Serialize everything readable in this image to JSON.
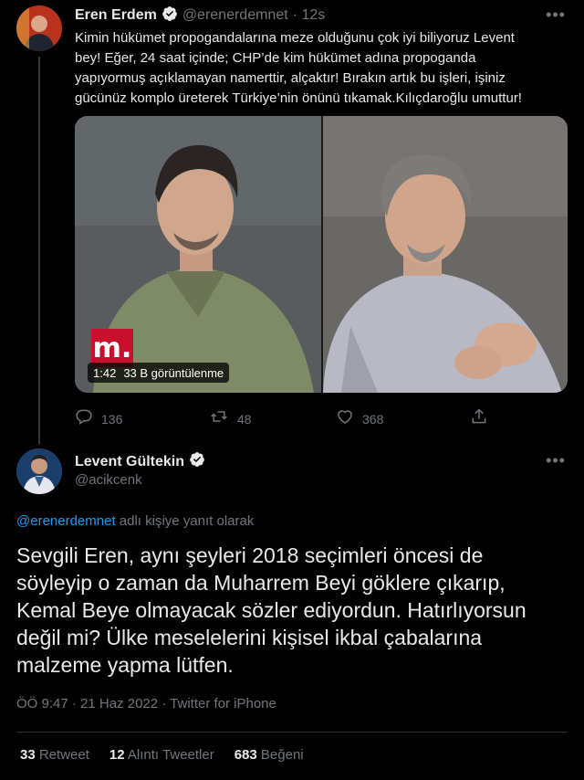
{
  "tweet1": {
    "display_name": "Eren Erdem",
    "handle": "@erenerdemnet",
    "time": "· 12s",
    "lines": [
      "Kimin hükümet propogandalarına meze olduğunu çok iyi biliyoruz Levent",
      "bey! Eğer, 24 saat içinde; CHP’de kim hükümet adına propoganda",
      "yapıyormuş açıklamayan namerttir, alçaktır! Bırakın artık bu işleri, işiniz",
      "gücünüz komplo üreterek Türkiye’nin önünü tıkamak.Kılıçdaroğlu umuttur!"
    ],
    "media": {
      "logo": "m.",
      "duration": "1:42",
      "views": "33 B görüntülenme"
    },
    "actions": {
      "replies": "136",
      "retweets": "48",
      "likes": "368"
    }
  },
  "tweet2": {
    "display_name": "Levent Gültekin",
    "handle": "@acikcenk",
    "reply_to_handle": "@erenerdemnet",
    "reply_to_suffix": " adlı kişiye yanıt olarak",
    "lines": [
      "Sevgili Eren, aynı şeyleri 2018 seçimleri öncesi de",
      "söyleyip o zaman da Muharrem Beyi göklere çıkarıp,",
      "Kemal Beye olmayacak sözler ediyordun. Hatırlıyorsun",
      "değil mi? Ülke meselelerini kişisel ikbal çabalarına",
      "malzeme yapma lütfen."
    ],
    "meta": "ÖÖ 9:47 · 21 Haz 2022 · Twitter for iPhone",
    "stats": {
      "retweets_count": "33",
      "retweets_label": "Retweet",
      "quotes_count": "12",
      "quotes_label": "Alıntı Tweetler",
      "likes_count": "683",
      "likes_label": "Beğeni"
    }
  },
  "colors": {
    "background": "#000000",
    "text": "#e7e9ea",
    "muted": "#71767b",
    "accent": "#1d9bf0",
    "media_logo": "#c8102e"
  }
}
